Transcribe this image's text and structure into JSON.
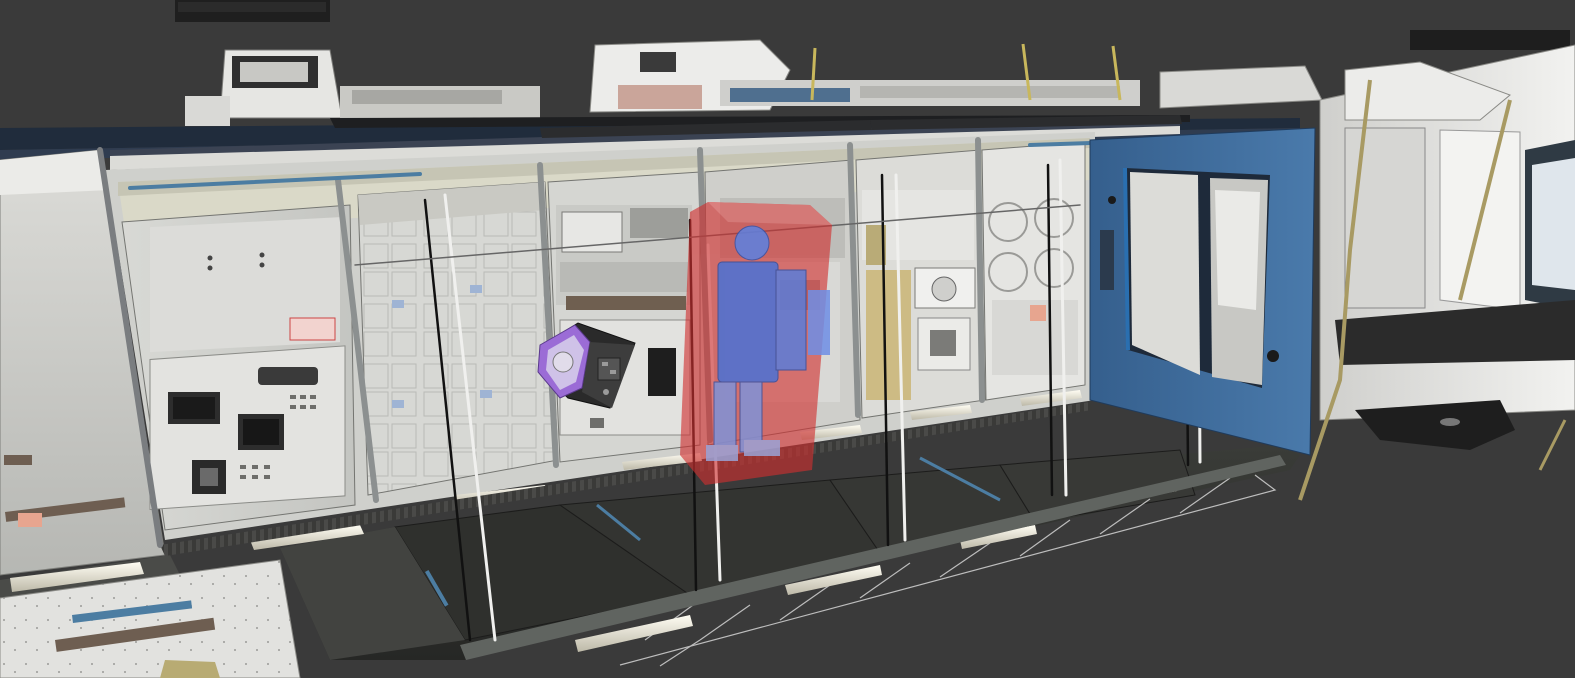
{
  "scene": {
    "background": "#3a3a3a",
    "colors": {
      "rack_white": "#e4e4e2",
      "rack_shadow": "#b9bab6",
      "panel_gray": "#cfd0cc",
      "floor_dark": "#2d2f2c",
      "frame_steel": "#8c9090",
      "hatch_blue": "#3d6a9a",
      "astrobee_purple": "#9b6cd6",
      "keepout_red": "#d12e2e",
      "crew_blue": "#4a72d6",
      "handrail_gold": "#a89a63",
      "grid_line": "#bdbdbd",
      "light_strip": "#f3f1e6"
    },
    "objects": {
      "module": "iss-module-interior",
      "robot": "astrobee-free-flyer",
      "crew_proxy": "astronaut-collision-model",
      "hatch": "blue-hatch-frame",
      "node": "adjacent-node-module"
    }
  }
}
